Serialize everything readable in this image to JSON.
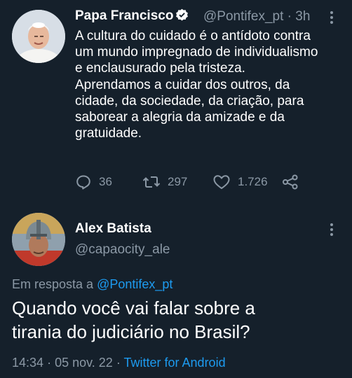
{
  "tweet": {
    "author_name": "Papa Francisco",
    "author_handle": "@Pontifex_pt",
    "separator": "·",
    "time": "3h",
    "text_lines": [
      "A cultura do cuidado é o antídoto contra",
      "um mundo impregnado de individualismo",
      "e enclausurado pela tristeza.",
      "Aprendamos a cuidar dos outros, da",
      "cidade, da sociedade, da criação, para",
      "saborear a alegria da amizade e da",
      "gratuidade."
    ],
    "replies": "36",
    "retweets": "297",
    "likes": "1.726"
  },
  "reply": {
    "author_name": "Alex Batista",
    "author_handle": "@capaocity_ale",
    "in_reply_prefix": "Em resposta a",
    "in_reply_mention": "@Pontifex_pt",
    "text_lines": [
      "Quando você vai falar sobre a",
      "tirania do judiciário no Brasil?"
    ],
    "time": "14:34",
    "separator": "·",
    "date": "05 nov. 22",
    "separator2": "·",
    "source": "Twitter for Android"
  },
  "colors": {
    "background": "#15202b",
    "text": "#ffffff",
    "secondary": "#8b98a5",
    "accent": "#1d9bf0"
  },
  "icons": {
    "verified": "verified-badge-icon",
    "more": "more-vertical-icon",
    "reply": "reply-icon",
    "retweet": "retweet-icon",
    "like": "heart-icon",
    "share": "share-icon"
  }
}
